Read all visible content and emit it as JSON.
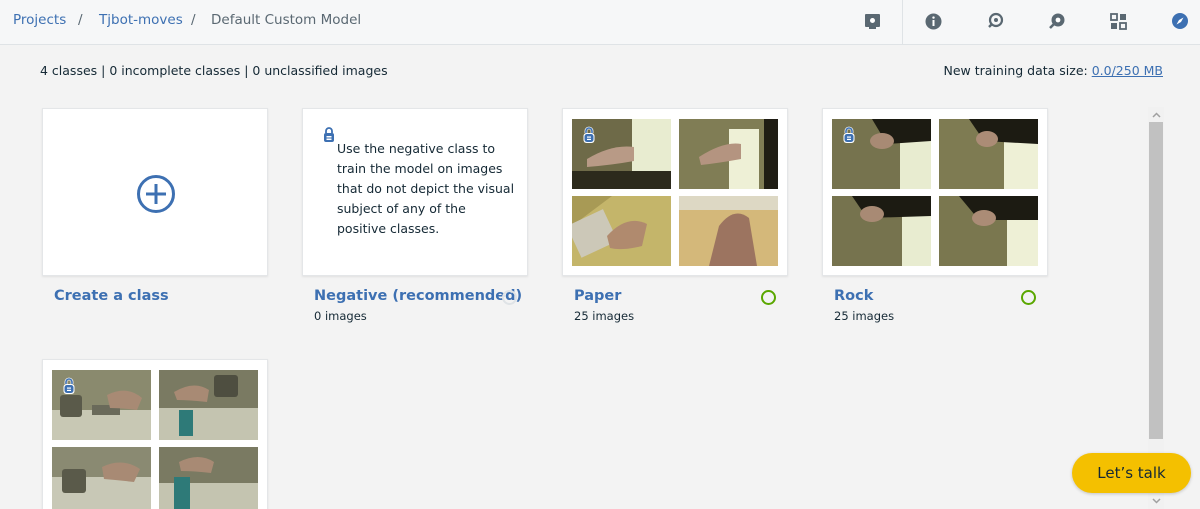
{
  "breadcrumb": {
    "projects": "Projects",
    "project": "Tjbot-moves",
    "current": "Default Custom Model",
    "separator": "/"
  },
  "toolbar": {
    "icons": [
      "dataset-icon",
      "info-icon",
      "test-icon",
      "train-icon",
      "grid-icon",
      "compass-icon"
    ]
  },
  "summary": {
    "text": "4 classes | 0 incomplete classes | 0 unclassified images",
    "data_size_label": "New training data size: ",
    "data_size_value": "0.0/250 MB"
  },
  "classes": [
    {
      "title": "Create a class"
    },
    {
      "title": "Negative (recommended)",
      "count": "0 images",
      "description": "Use the negative class to train the model on images that do not depict the visual subject of any of the positive classes.",
      "status": "empty"
    },
    {
      "title": "Paper",
      "count": "25 images",
      "status": "ok"
    },
    {
      "title": "Rock",
      "count": "25 images",
      "status": "ok"
    }
  ],
  "chat": {
    "label": "Let’s talk"
  },
  "colors": {
    "accent": "#3d70b2",
    "ok": "#5aa700",
    "chat": "#f4c000"
  }
}
